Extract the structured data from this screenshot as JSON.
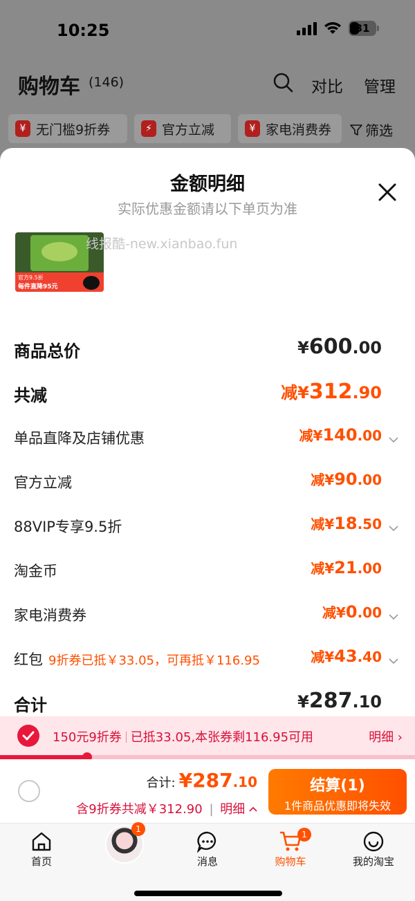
{
  "status_bar": {
    "time": "10:25",
    "battery": "31"
  },
  "header": {
    "title": "购物车",
    "count": "(146)",
    "compare": "对比",
    "manage": "管理"
  },
  "chips": [
    {
      "icon": "¥",
      "label": "无门槛9折券"
    },
    {
      "icon": "⚡",
      "label": "官方立减"
    },
    {
      "icon": "¥",
      "label": "家电消费券"
    }
  ],
  "filter": "筛选",
  "sheet": {
    "title": "金额明细",
    "subtitle": "实际优惠金额请以下单页为准",
    "watermark": "线报酷-new.xianbao.fun",
    "thumb_badge_top": "官方9.5折",
    "thumb_badge_main": "每件直降95元",
    "rows": [
      {
        "label": "商品总价",
        "prefix": "¥",
        "int": "600",
        "dec": ".00",
        "note": ""
      },
      {
        "label": "共减",
        "prefix": "减¥",
        "int": "312",
        "dec": ".90",
        "note": ""
      },
      {
        "label": "单品直降及店铺优惠",
        "prefix": "减¥",
        "int": "140",
        "dec": ".00",
        "note": ""
      },
      {
        "label": "官方立减",
        "prefix": "减¥",
        "int": "90",
        "dec": ".00",
        "note": ""
      },
      {
        "label": "88VIP专享9.5折",
        "prefix": "减¥",
        "int": "18",
        "dec": ".50",
        "note": ""
      },
      {
        "label": "淘金币",
        "prefix": "减¥",
        "int": "21",
        "dec": ".00",
        "note": ""
      },
      {
        "label": "家电消费券",
        "prefix": "减¥",
        "int": "0",
        "dec": ".00",
        "note": ""
      },
      {
        "label": "红包",
        "prefix": "减¥",
        "int": "43",
        "dec": ".40",
        "note": "9折券已抵￥33.05，可再抵￥116.95"
      },
      {
        "label": "合计",
        "prefix": "¥",
        "int": "287",
        "dec": ".10",
        "note": ""
      }
    ]
  },
  "coupon": {
    "name": "150元9折券",
    "status": "已抵33.05,本张券剩116.95可用",
    "detail": "明细 ›",
    "progress": 0.21
  },
  "checkout": {
    "total_label": "合计:",
    "total_int": "¥287",
    "total_dec": ".10",
    "discount_text": "含9折券共减￥312.90",
    "detail_toggle": "明细",
    "button_main": "结算(1)",
    "button_sub": "1件商品优惠即将失效"
  },
  "tabs": [
    {
      "label": "首页",
      "badge": ""
    },
    {
      "label": "",
      "badge": "1"
    },
    {
      "label": "消息",
      "badge": ""
    },
    {
      "label": "购物车",
      "badge": "1"
    },
    {
      "label": "我的淘宝",
      "badge": ""
    }
  ],
  "colors": {
    "accent": "#ff5000",
    "coupon_red": "#e8173c"
  }
}
